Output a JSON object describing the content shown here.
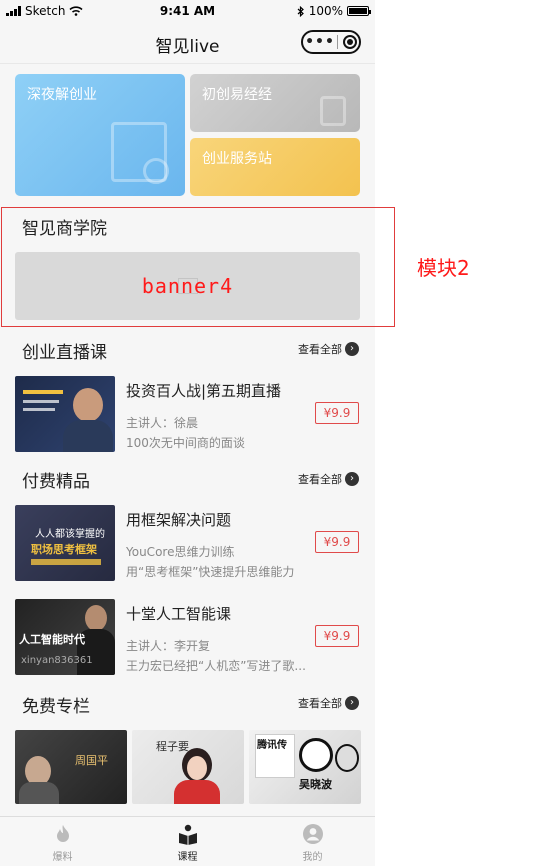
{
  "status_bar": {
    "carrier": "Sketch",
    "time": "9:41 AM",
    "battery": "100%"
  },
  "nav": {
    "title": "智见live"
  },
  "cards": [
    {
      "label": "深夜解创业",
      "color": "#7cc3f2"
    },
    {
      "label": "初创易经经",
      "color": "#c4c4c4"
    },
    {
      "label": "创业服务站",
      "color": "#f5c959"
    }
  ],
  "business_school": {
    "title": "智见商学院",
    "banner_text": "banner4"
  },
  "annotation": {
    "module_label": "模块2"
  },
  "live_section": {
    "title": "创业直播课",
    "see_all": "查看全部"
  },
  "paid_section": {
    "title": "付费精品",
    "see_all": "查看全部"
  },
  "free_section": {
    "title": "免费专栏",
    "see_all": "查看全部"
  },
  "courses": [
    {
      "name": "投资百人战|第五期直播",
      "sub1": "主讲人：徐晨",
      "sub2": "100次无中间商的面谈",
      "price": "¥9.9"
    },
    {
      "name": "用框架解决问题",
      "sub1": "YouCore思维力训练",
      "sub2": "用“思考框架”快速提升思维能力",
      "price": "¥9.9"
    },
    {
      "name": "十堂人工智能课",
      "sub1": "主讲人：李开复",
      "sub2": "王力宏已经把“人机恋”写进了歌...",
      "price": "¥9.9"
    }
  ],
  "thumbs": {
    "t2_title": "人人都该掌握的",
    "t2_main": "职场思考框架",
    "t3_main": "人工智能时代",
    "t3_watermark": "xinyan836361",
    "f1_name": "周国平",
    "f2_name": "程子要",
    "f3_title": "腾讯传",
    "f3_name": "吴晓波"
  },
  "tabs": [
    {
      "label": "爆料",
      "icon": "fire-icon"
    },
    {
      "label": "课程",
      "icon": "book-icon"
    },
    {
      "label": "我的",
      "icon": "user-icon"
    }
  ],
  "colors": {
    "accent_red": "#e04a4a",
    "annotation_red": "#ff1a1a"
  }
}
